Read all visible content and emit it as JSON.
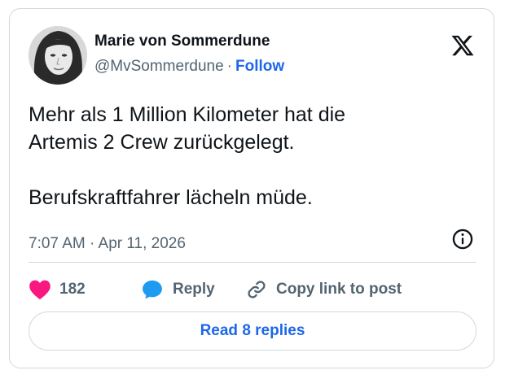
{
  "author": {
    "name": "Marie von Sommerdune",
    "handle": "@MvSommerdune",
    "separator": "·",
    "follow_label": "Follow"
  },
  "tweet": {
    "paragraph_1_line_1": "Mehr als 1 Million Kilometer hat die",
    "paragraph_1_line_2": "Artemis 2 Crew zurückgelegt.",
    "paragraph_2": "Berufskraftfahrer lächeln müde.",
    "timestamp": "7:07 AM · Apr 11, 2026"
  },
  "actions": {
    "like_count": "182",
    "reply_label": "Reply",
    "copy_label": "Copy link to post"
  },
  "footer": {
    "read_replies_label": "Read 8 replies"
  },
  "icons": {
    "logo": "x-logo-icon",
    "info": "info-icon",
    "like": "heart-icon",
    "reply": "speech-bubble-icon",
    "copy": "link-icon"
  },
  "colors": {
    "accent": "#1d67e8",
    "like": "#f91880",
    "reply_icon": "#1d9bf0",
    "muted_text": "#536471",
    "border": "#cfd9de"
  }
}
